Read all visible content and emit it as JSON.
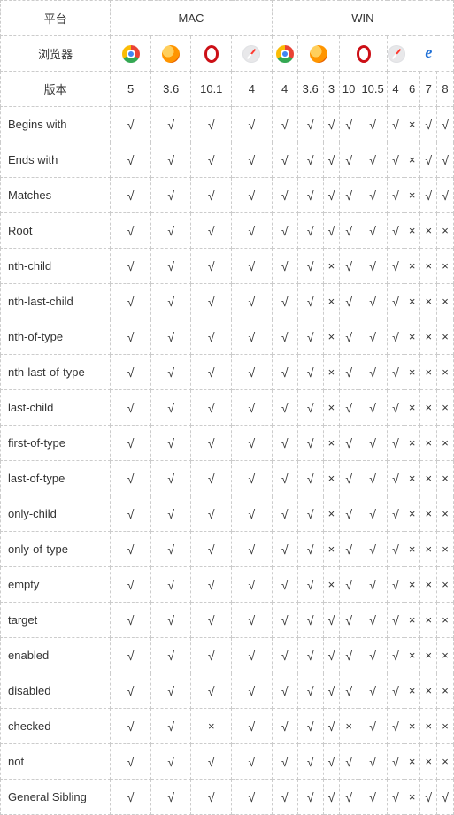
{
  "header": {
    "platform_label": "平台",
    "browser_label": "浏览器",
    "version_label": "版本",
    "mac_label": "MAC",
    "win_label": "WIN"
  },
  "browsers": {
    "mac": [
      "chrome",
      "firefox",
      "opera",
      "safari"
    ],
    "win": [
      "chrome",
      "firefox",
      "opera",
      "safari",
      "ie"
    ]
  },
  "versions": {
    "mac": [
      "5",
      "3.6",
      "10.1",
      "4"
    ],
    "win": [
      "4",
      "3.6",
      "3",
      "10",
      "10.5",
      "4",
      "6",
      "7",
      "8"
    ]
  },
  "marks": {
    "yes": "√",
    "no": "×"
  },
  "rows": [
    {
      "label": "Begins with",
      "v": [
        1,
        1,
        1,
        1,
        1,
        1,
        1,
        1,
        1,
        1,
        0,
        1,
        1
      ]
    },
    {
      "label": "Ends with",
      "v": [
        1,
        1,
        1,
        1,
        1,
        1,
        1,
        1,
        1,
        1,
        0,
        1,
        1
      ]
    },
    {
      "label": "Matches",
      "v": [
        1,
        1,
        1,
        1,
        1,
        1,
        1,
        1,
        1,
        1,
        0,
        1,
        1
      ]
    },
    {
      "label": "Root",
      "v": [
        1,
        1,
        1,
        1,
        1,
        1,
        1,
        1,
        1,
        1,
        0,
        0,
        0
      ]
    },
    {
      "label": "nth-child",
      "v": [
        1,
        1,
        1,
        1,
        1,
        1,
        0,
        1,
        1,
        1,
        0,
        0,
        0
      ]
    },
    {
      "label": "nth-last-child",
      "v": [
        1,
        1,
        1,
        1,
        1,
        1,
        0,
        1,
        1,
        1,
        0,
        0,
        0
      ]
    },
    {
      "label": "nth-of-type",
      "v": [
        1,
        1,
        1,
        1,
        1,
        1,
        0,
        1,
        1,
        1,
        0,
        0,
        0
      ]
    },
    {
      "label": "nth-last-of-type",
      "v": [
        1,
        1,
        1,
        1,
        1,
        1,
        0,
        1,
        1,
        1,
        0,
        0,
        0
      ]
    },
    {
      "label": "last-child",
      "v": [
        1,
        1,
        1,
        1,
        1,
        1,
        0,
        1,
        1,
        1,
        0,
        0,
        0
      ]
    },
    {
      "label": "first-of-type",
      "v": [
        1,
        1,
        1,
        1,
        1,
        1,
        0,
        1,
        1,
        1,
        0,
        0,
        0
      ]
    },
    {
      "label": "last-of-type",
      "v": [
        1,
        1,
        1,
        1,
        1,
        1,
        0,
        1,
        1,
        1,
        0,
        0,
        0
      ]
    },
    {
      "label": "only-child",
      "v": [
        1,
        1,
        1,
        1,
        1,
        1,
        0,
        1,
        1,
        1,
        0,
        0,
        0
      ]
    },
    {
      "label": "only-of-type",
      "v": [
        1,
        1,
        1,
        1,
        1,
        1,
        0,
        1,
        1,
        1,
        0,
        0,
        0
      ]
    },
    {
      "label": "empty",
      "v": [
        1,
        1,
        1,
        1,
        1,
        1,
        0,
        1,
        1,
        1,
        0,
        0,
        0
      ]
    },
    {
      "label": "target",
      "v": [
        1,
        1,
        1,
        1,
        1,
        1,
        1,
        1,
        1,
        1,
        0,
        0,
        0
      ]
    },
    {
      "label": "enabled",
      "v": [
        1,
        1,
        1,
        1,
        1,
        1,
        1,
        1,
        1,
        1,
        0,
        0,
        0
      ]
    },
    {
      "label": "disabled",
      "v": [
        1,
        1,
        1,
        1,
        1,
        1,
        1,
        1,
        1,
        1,
        0,
        0,
        0
      ]
    },
    {
      "label": "checked",
      "v": [
        1,
        1,
        0,
        1,
        1,
        1,
        1,
        0,
        1,
        1,
        0,
        0,
        0
      ]
    },
    {
      "label": "not",
      "v": [
        1,
        1,
        1,
        1,
        1,
        1,
        1,
        1,
        1,
        1,
        0,
        0,
        0
      ]
    },
    {
      "label": "General Sibling",
      "v": [
        1,
        1,
        1,
        1,
        1,
        1,
        1,
        1,
        1,
        1,
        0,
        1,
        1
      ]
    }
  ]
}
